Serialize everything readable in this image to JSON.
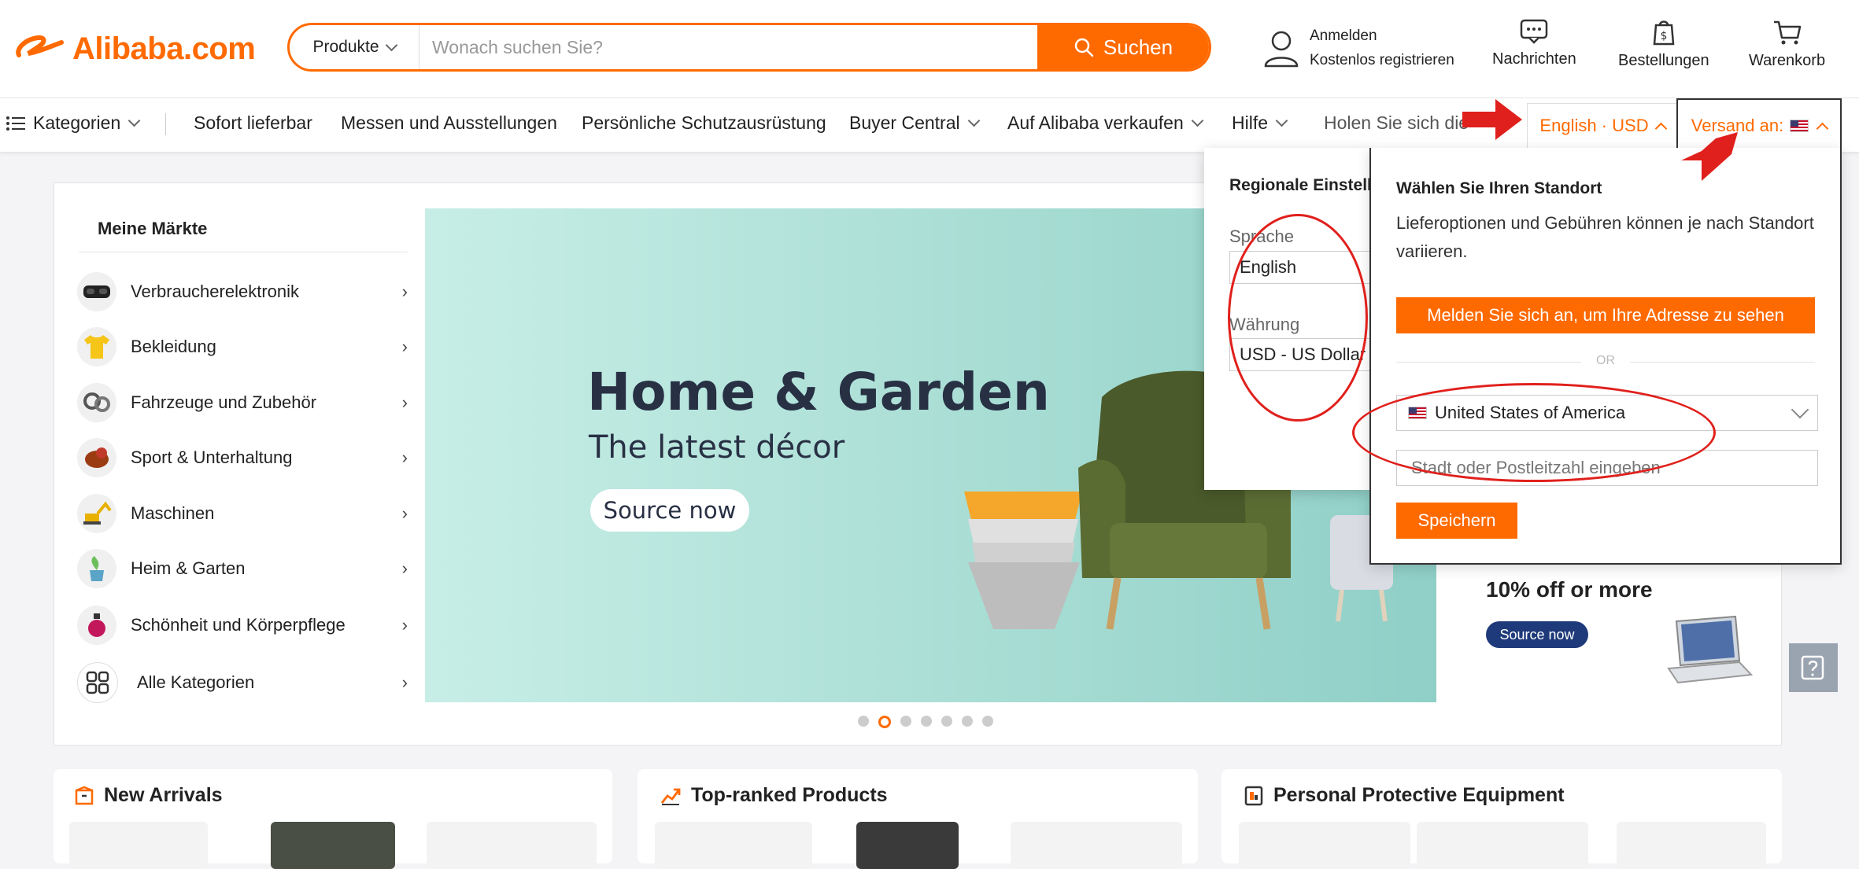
{
  "header": {
    "logo_text": "Alibaba.com",
    "search": {
      "category": "Produkte",
      "placeholder": "Wonach suchen Sie?",
      "button": "Suchen"
    },
    "account": {
      "signin": "Anmelden",
      "register": "Kostenlos registrieren"
    },
    "messages": "Nachrichten",
    "orders": "Bestellungen",
    "cart": "Warenkorb"
  },
  "nav": {
    "categories": "Kategorien",
    "items": [
      "Sofort lieferbar",
      "Messen und Ausstellungen",
      "Persönliche Schutzausrüstung",
      "Buyer Central",
      "Auf Alibaba verkaufen",
      "Hilfe",
      "Holen Sie sich die"
    ],
    "language_currency": "English · USD",
    "ship_to": "Versand an:"
  },
  "markets": {
    "title": "Meine Märkte",
    "items": [
      {
        "label": "Verbraucherelektronik",
        "icon": "vr-headset-icon"
      },
      {
        "label": "Bekleidung",
        "icon": "shirt-icon"
      },
      {
        "label": "Fahrzeuge und Zubehör",
        "icon": "car-parts-icon"
      },
      {
        "label": "Sport & Unterhaltung",
        "icon": "ball-icon"
      },
      {
        "label": "Maschinen",
        "icon": "excavator-icon"
      },
      {
        "label": "Heim & Garten",
        "icon": "garden-icon"
      },
      {
        "label": "Schönheit und Körperpflege",
        "icon": "perfume-icon"
      },
      {
        "label": "Alle Kategorien",
        "icon": "grid-icon"
      }
    ]
  },
  "banner": {
    "title": "Home & Garden",
    "subtitle": "The latest décor",
    "button": "Source now",
    "slides": 7,
    "active_slide": 2
  },
  "promo": {
    "title": "10% off or more",
    "button": "Source now"
  },
  "sections": [
    {
      "title": "New Arrivals",
      "icon": "box-icon"
    },
    {
      "title": "Top-ranked Products",
      "icon": "trend-icon"
    },
    {
      "title": "Personal Protective Equipment",
      "icon": "ppe-icon"
    }
  ],
  "region_dropdown": {
    "title": "Regionale Einstell",
    "language_label": "Sprache",
    "language_value": "English",
    "currency_label": "Währung",
    "currency_value": "USD - US Dollar"
  },
  "ship_dropdown": {
    "title": "Wählen Sie Ihren Standort",
    "description": "Lieferoptionen und Gebühren können je nach Standort variieren.",
    "login_button": "Melden Sie sich an, um Ihre Adresse zu sehen",
    "or": "OR",
    "country": "United States of America",
    "city_placeholder": "Stadt oder Postleitzahl eingeben",
    "save_button": "Speichern"
  },
  "colors": {
    "accent": "#ff6a00",
    "annotation": "#e0201c",
    "banner_text": "#283044"
  }
}
